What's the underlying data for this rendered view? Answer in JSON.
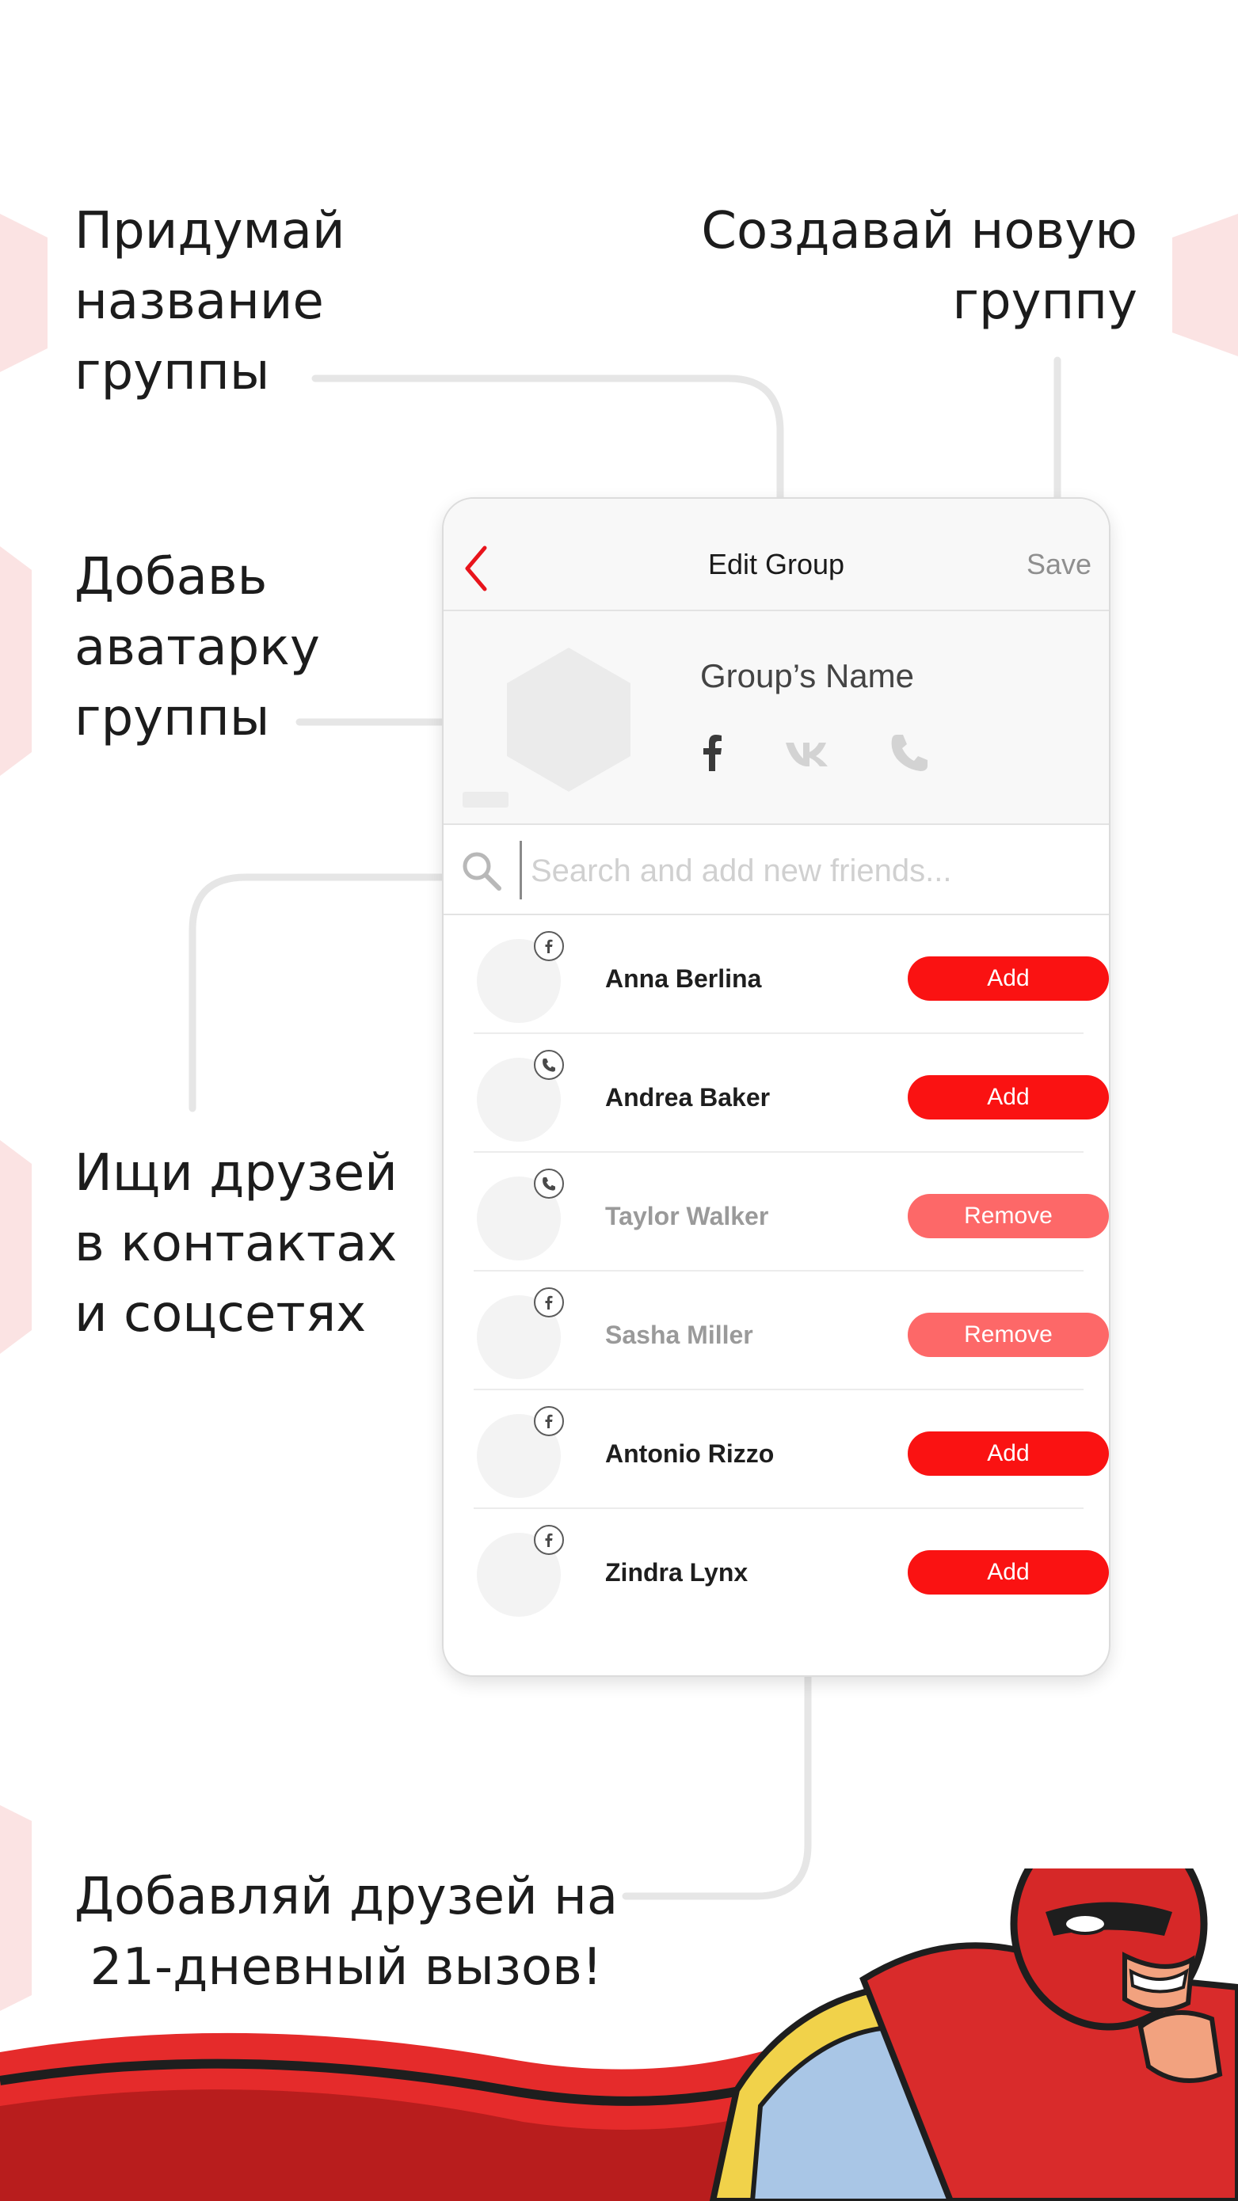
{
  "captions": {
    "name_group": "Придумай\nназвание\nгруппы",
    "create_group": "Создавай новую\nгруппу",
    "add_avatar": "Добавь\nаватарку\nгруппы",
    "search_friends": "Ищи друзей\nв контактах\nи соцсетях",
    "add_friends": "Добавляй друзей на\n21-дневный вызов!"
  },
  "nav": {
    "back_icon": "chevron-left-icon",
    "title": "Edit Group",
    "save_label": "Save"
  },
  "group": {
    "name": "Group’s Name",
    "avatar_icon": "hexagon-placeholder",
    "social_icons": [
      "facebook-icon",
      "vk-icon",
      "phone-icon"
    ]
  },
  "search": {
    "placeholder": "Search and add new friends..."
  },
  "friends": [
    {
      "name": "Anna Berlina",
      "source": "facebook",
      "action": "Add",
      "muted": false
    },
    {
      "name": "Andrea Baker",
      "source": "phone",
      "action": "Add",
      "muted": false
    },
    {
      "name": "Taylor Walker",
      "source": "phone",
      "action": "Remove",
      "muted": true
    },
    {
      "name": "Sasha Miller",
      "source": "facebook",
      "action": "Remove",
      "muted": true
    },
    {
      "name": "Antonio Rizzo",
      "source": "facebook",
      "action": "Add",
      "muted": false
    },
    {
      "name": "Zindra Lynx",
      "source": "facebook",
      "action": "Add",
      "muted": false
    }
  ],
  "colors": {
    "accent_red": "#fa1212",
    "remove_red": "#fd6868",
    "back_arrow": "#e8141c"
  }
}
